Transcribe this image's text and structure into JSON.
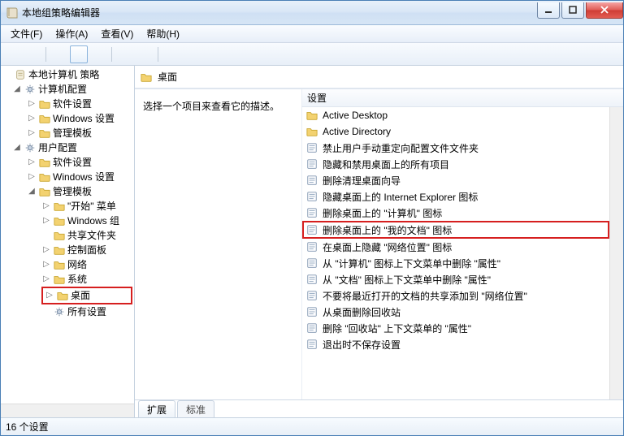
{
  "window": {
    "title": "本地组策略编辑器"
  },
  "menu": {
    "file": "文件(F)",
    "action": "操作(A)",
    "view": "查看(V)",
    "help": "帮助(H)"
  },
  "tree": {
    "root": "本地计算机 策略",
    "computer": "计算机配置",
    "c_software": "软件设置",
    "c_windows": "Windows 设置",
    "c_templates": "管理模板",
    "user": "用户配置",
    "u_software": "软件设置",
    "u_windows": "Windows 设置",
    "u_templates": "管理模板",
    "start_menu": "\"开始\" 菜单",
    "windows_components": "Windows 组",
    "shared_folders": "共享文件夹",
    "control_panel": "控制面板",
    "network": "网络",
    "system": "系统",
    "desktop": "桌面",
    "all_settings": "所有设置"
  },
  "crumb": {
    "label": "桌面"
  },
  "description": "选择一个项目来查看它的描述。",
  "list": {
    "header": "设置",
    "items": [
      {
        "type": "folder",
        "label": "Active Desktop"
      },
      {
        "type": "folder",
        "label": "Active Directory"
      },
      {
        "type": "policy",
        "label": "禁止用户手动重定向配置文件文件夹"
      },
      {
        "type": "policy",
        "label": "隐藏和禁用桌面上的所有项目"
      },
      {
        "type": "policy",
        "label": "删除清理桌面向导"
      },
      {
        "type": "policy",
        "label": "隐藏桌面上的 Internet Explorer 图标"
      },
      {
        "type": "policy",
        "label": "删除桌面上的 \"计算机\" 图标"
      },
      {
        "type": "policy",
        "label": "删除桌面上的 \"我的文档\" 图标",
        "highlight": true
      },
      {
        "type": "policy",
        "label": "在桌面上隐藏 \"网络位置\" 图标"
      },
      {
        "type": "policy",
        "label": "从 \"计算机\" 图标上下文菜单中删除 \"属性\""
      },
      {
        "type": "policy",
        "label": "从 \"文档\" 图标上下文菜单中删除  \"属性\""
      },
      {
        "type": "policy",
        "label": "不要将最近打开的文档的共享添加到 \"网络位置\""
      },
      {
        "type": "policy",
        "label": "从桌面删除回收站"
      },
      {
        "type": "policy",
        "label": "删除 \"回收站\" 上下文菜单的 \"属性\""
      },
      {
        "type": "policy",
        "label": "退出时不保存设置"
      }
    ]
  },
  "tabs": {
    "extended": "扩展",
    "standard": "标准"
  },
  "status": "16 个设置"
}
